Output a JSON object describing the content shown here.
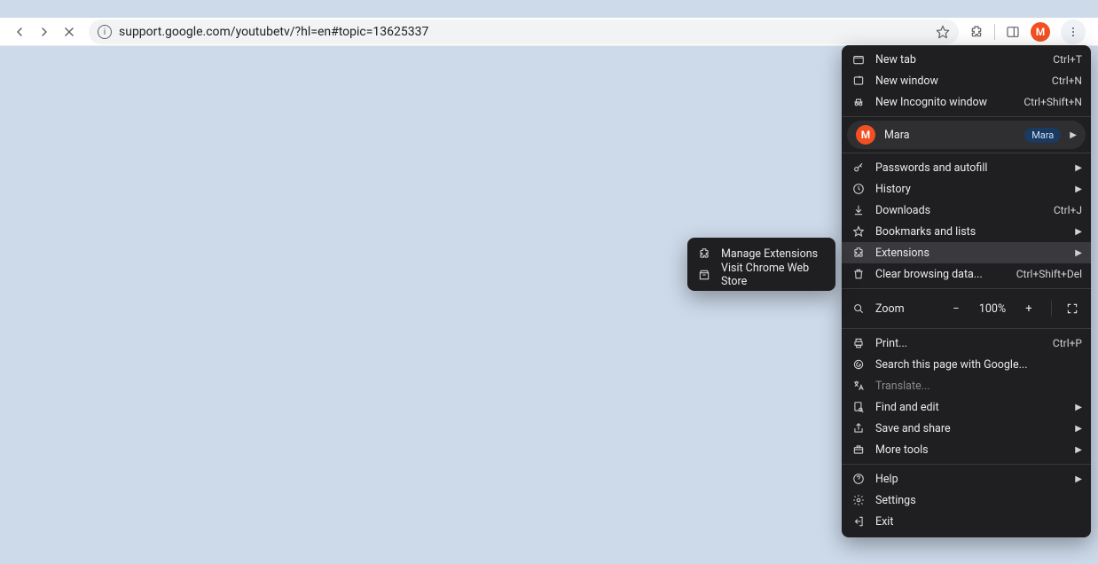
{
  "toolbar": {
    "url": "support.google.com/youtubetv/?hl=en#topic=13625337",
    "profile_initial": "M"
  },
  "menu": {
    "new_tab": {
      "label": "New tab",
      "shortcut": "Ctrl+T"
    },
    "new_window": {
      "label": "New window",
      "shortcut": "Ctrl+N"
    },
    "new_incognito": {
      "label": "New Incognito window",
      "shortcut": "Ctrl+Shift+N"
    },
    "profile": {
      "name": "Mara",
      "badge": "Mara",
      "initial": "M"
    },
    "passwords": {
      "label": "Passwords and autofill"
    },
    "history": {
      "label": "History"
    },
    "downloads": {
      "label": "Downloads",
      "shortcut": "Ctrl+J"
    },
    "bookmarks": {
      "label": "Bookmarks and lists"
    },
    "extensions": {
      "label": "Extensions"
    },
    "clear_data": {
      "label": "Clear browsing data...",
      "shortcut": "Ctrl+Shift+Del"
    },
    "zoom": {
      "label": "Zoom",
      "value": "100%"
    },
    "print": {
      "label": "Print...",
      "shortcut": "Ctrl+P"
    },
    "search_page": {
      "label": "Search this page with Google..."
    },
    "translate": {
      "label": "Translate..."
    },
    "find_edit": {
      "label": "Find and edit"
    },
    "save_share": {
      "label": "Save and share"
    },
    "more_tools": {
      "label": "More tools"
    },
    "help": {
      "label": "Help"
    },
    "settings": {
      "label": "Settings"
    },
    "exit": {
      "label": "Exit"
    }
  },
  "submenu": {
    "manage": "Manage Extensions",
    "store": "Visit Chrome Web Store"
  }
}
